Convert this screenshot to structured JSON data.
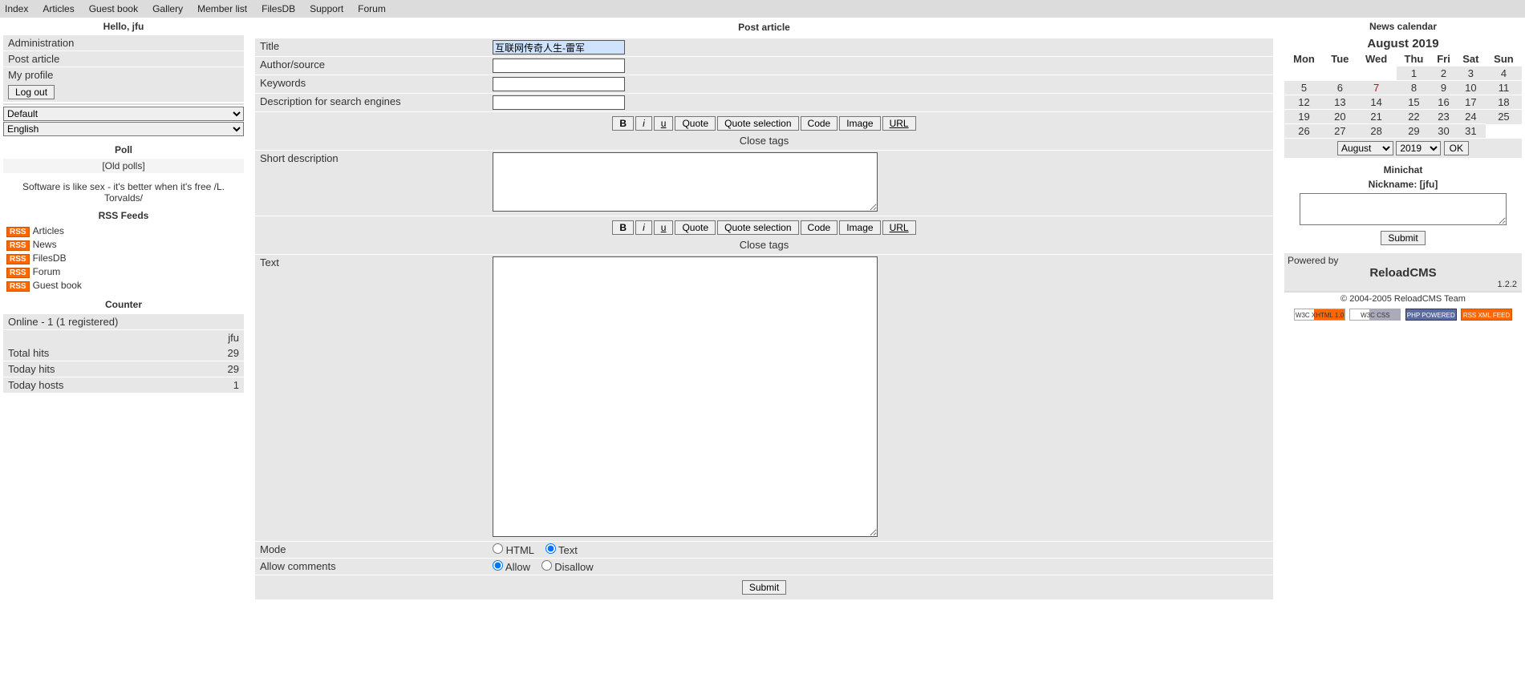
{
  "nav": [
    "Index",
    "Articles",
    "Guest book",
    "Gallery",
    "Member list",
    "FilesDB",
    "Support",
    "Forum"
  ],
  "left": {
    "hello": "Hello, jfu",
    "menu": [
      "Administration",
      "Post article",
      "My profile"
    ],
    "logout": "Log out",
    "skin_sel": "Default",
    "lang_sel": "English",
    "poll_title": "Poll",
    "old_polls": "[Old polls]",
    "quote": "Software is like sex - it's better when it's free /L. Torvalds/",
    "rss_title": "RSS Feeds",
    "rss_items": [
      "Articles",
      "News",
      "FilesDB",
      "Forum",
      "Guest book"
    ],
    "counter_title": "Counter",
    "online": "Online - 1 (1 registered)",
    "who": "jfu",
    "stats": [
      {
        "k": "Total hits",
        "v": "29"
      },
      {
        "k": "Today hits",
        "v": "29"
      },
      {
        "k": "Today hosts",
        "v": "1"
      }
    ]
  },
  "form": {
    "heading": "Post article",
    "fields": {
      "title_lbl": "Title",
      "title_val": "互联网传奇人生-雷军",
      "author_lbl": "Author/source",
      "author_val": "",
      "keywords_lbl": "Keywords",
      "keywords_val": "",
      "desc_lbl": "Description for search engines",
      "desc_val": ""
    },
    "tb": {
      "b": "B",
      "i": "i",
      "u": "u",
      "quote": "Quote",
      "qsel": "Quote selection",
      "code": "Code",
      "img": "Image",
      "url": "URL",
      "close": "Close tags"
    },
    "short_lbl": "Short description",
    "short_val": "",
    "text_lbl": "Text",
    "text_val": "",
    "mode_lbl": "Mode",
    "mode_html": "HTML",
    "mode_text": "Text",
    "allow_lbl": "Allow comments",
    "allow_yes": "Allow",
    "allow_no": "Disallow",
    "submit": "Submit"
  },
  "right": {
    "cal_title": "News calendar",
    "month": "August 2019",
    "dow": [
      "Mon",
      "Tue",
      "Wed",
      "Thu",
      "Fri",
      "Sat",
      "Sun"
    ],
    "weeks": [
      [
        "",
        "",
        "",
        "1",
        "2",
        "3",
        "4"
      ],
      [
        "5",
        "6",
        "7",
        "8",
        "9",
        "10",
        "11"
      ],
      [
        "12",
        "13",
        "14",
        "15",
        "16",
        "17",
        "18"
      ],
      [
        "19",
        "20",
        "21",
        "22",
        "23",
        "24",
        "25"
      ],
      [
        "26",
        "27",
        "28",
        "29",
        "30",
        "31",
        ""
      ]
    ],
    "today": "7",
    "sel_month": "August",
    "sel_year": "2019",
    "ok": "OK",
    "mc_title": "Minichat",
    "mc_nick": "Nickname: [jfu]",
    "mc_submit": "Submit",
    "pw_label": "Powered by",
    "pw_name": "ReloadCMS",
    "pw_ver": "1.2.2",
    "pw_copy": "© 2004-2005 ReloadCMS Team",
    "badges": [
      "W3C XHTML 1.0",
      "W3C CSS",
      "PHP POWERED",
      "RSS XML FEED"
    ]
  }
}
